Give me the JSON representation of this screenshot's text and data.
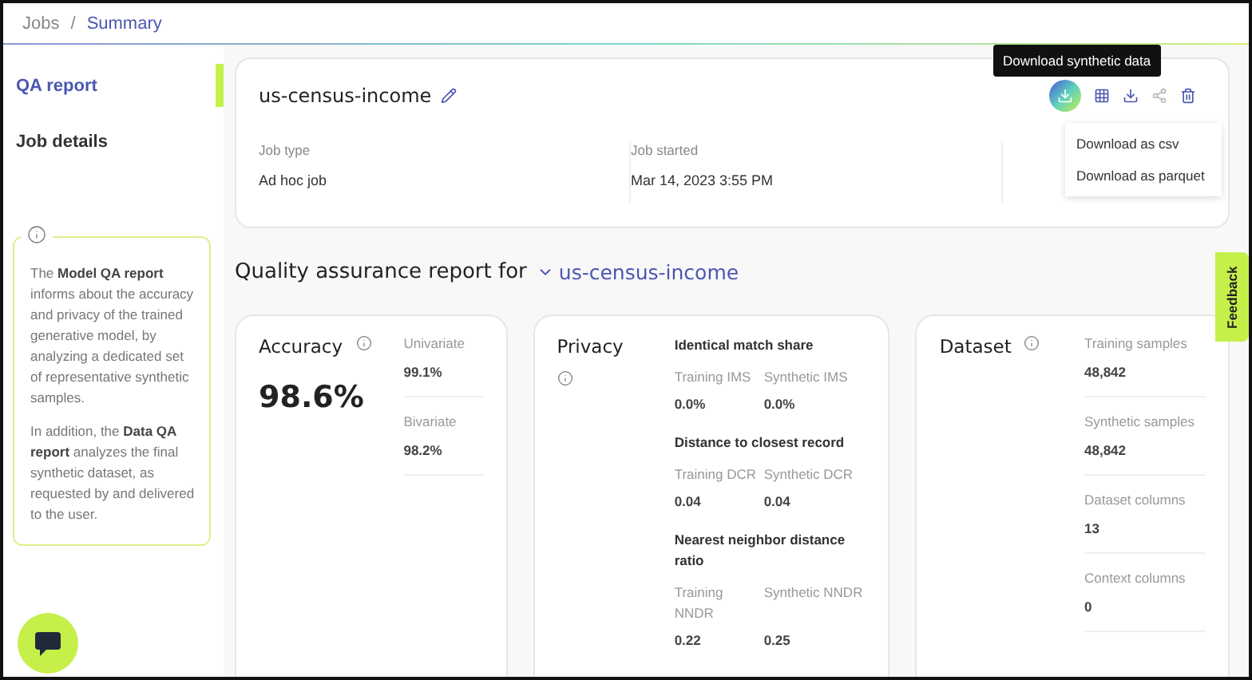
{
  "breadcrumb": [
    {
      "label": "Jobs",
      "selected": false
    },
    {
      "label": "Summary",
      "selected": true
    }
  ],
  "breadcrumb_separator": "/",
  "sidebar": {
    "items": [
      {
        "label": "QA report",
        "selected": true
      },
      {
        "label": "Job details",
        "selected": false
      }
    ],
    "info": [
      "The **Model QA report** informs about the accuracy and privacy of the trained generative model, by analyzing a dedicated set of representative synthetic samples.",
      "In addition, the **Data QA report** analyzes the final synthetic dataset, as requested by and delivered to the user."
    ]
  },
  "job": {
    "title": "us-census-income",
    "fields": [
      {
        "label": "Job type",
        "value": "Ad hoc job"
      },
      {
        "label": "Job started",
        "value": "Mar 14, 2023 3:55 PM"
      }
    ],
    "tooltip": "Download synthetic data",
    "menu": [
      "Download as csv",
      "Download as parquet"
    ]
  },
  "report": {
    "heading": "Quality assurance report for",
    "dataset": "us-census-income"
  },
  "cards": [
    {
      "kind": "accuracy",
      "title": "Accuracy",
      "value": "98.6%",
      "metrics": [
        {
          "label": "Univariate",
          "value": "99.1%"
        },
        {
          "label": "Bivariate",
          "value": "98.2%"
        }
      ]
    },
    {
      "kind": "privacy",
      "title": "Privacy",
      "groups": [
        {
          "title": "Identical match share",
          "metrics": [
            {
              "label": "Training IMS",
              "value": "0.0%"
            },
            {
              "label": "Synthetic IMS",
              "value": "0.0%"
            }
          ]
        },
        {
          "title": "Distance to closest record",
          "metrics": [
            {
              "label": "Training DCR",
              "value": "0.04"
            },
            {
              "label": "Synthetic DCR",
              "value": "0.04"
            }
          ]
        },
        {
          "title": "Nearest neighbor distance ratio",
          "metrics": [
            {
              "label": "Training NNDR",
              "value": "0.22"
            },
            {
              "label": "Synthetic NNDR",
              "value": "0.25"
            }
          ]
        }
      ]
    },
    {
      "kind": "dataset",
      "title": "Dataset",
      "metrics": [
        {
          "label": "Training samples",
          "value": "48,842"
        },
        {
          "label": "Synthetic samples",
          "value": "48,842"
        },
        {
          "label": "Dataset columns",
          "value": "13"
        },
        {
          "label": "Context columns",
          "value": "0"
        }
      ]
    }
  ],
  "feedback": "Feedback"
}
